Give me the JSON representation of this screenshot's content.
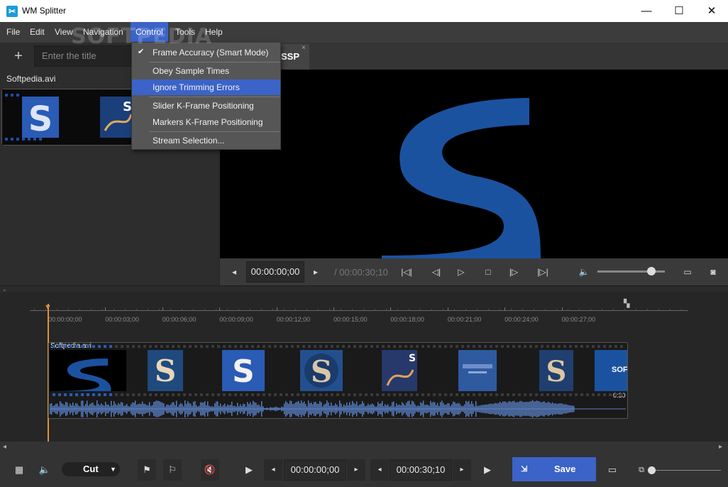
{
  "window": {
    "title": "WM Splitter",
    "minimize": "—",
    "maximize": "☐",
    "close": "✕"
  },
  "menubar": {
    "items": [
      "File",
      "Edit",
      "View",
      "Navigation",
      "Control",
      "Tools",
      "Help"
    ],
    "active": "Control",
    "watermark": "SOFTPEDIA"
  },
  "control_menu": {
    "items": [
      {
        "label": "Frame Accuracy (Smart Mode)",
        "checked": true
      },
      {
        "label": "Obey Sample Times"
      },
      {
        "label": "Ignore Trimming Errors",
        "highlighted": true
      },
      {
        "label": "Slider K-Frame Positioning"
      },
      {
        "label": "Markers K-Frame Positioning"
      },
      {
        "label": "Stream Selection..."
      }
    ]
  },
  "left_panel": {
    "add": "+",
    "title_placeholder": "Enter the title",
    "clip_name": "Softpedia.avi"
  },
  "tab": {
    "label": "SSP",
    "close": "×"
  },
  "player": {
    "current_time": "00:00:00;00",
    "duration": "/ 00:00:30;10",
    "volume": 0.8
  },
  "timeline": {
    "ticks": [
      "00:00:00;00",
      "00:00:03;00",
      "00:00:06;00",
      "00:00:09;00",
      "00:00:12;00",
      "00:00:15;00",
      "00:00:18;00",
      "00:00:21;00",
      "00:00:24;00",
      "00:00:27;00"
    ],
    "clip_name": "Softpedia.avi",
    "clip_duration": "0:30",
    "thumb_last": "SOF"
  },
  "bottombar": {
    "mode": "Cut",
    "start_time": "00:00:00;00",
    "end_time": "00:00:30;10",
    "save": "Save"
  },
  "colors": {
    "accent": "#3b63c8",
    "playhead": "#e0913a",
    "logo_blue": "#1b52a0",
    "wave": "#5a82c8"
  }
}
